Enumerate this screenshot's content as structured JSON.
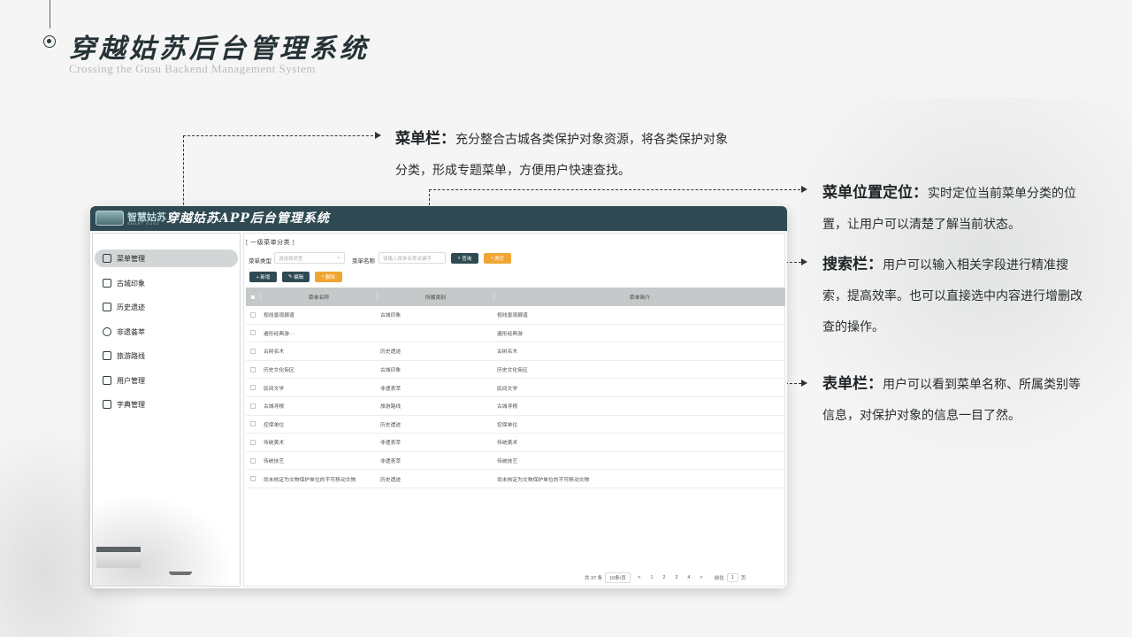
{
  "header": {
    "title": "穿越姑苏后台管理系统",
    "subtitle": "Crossing the Gusu Backend Management System"
  },
  "annotations": [
    {
      "heading": "菜单栏：",
      "text": "充分整合古城各类保护对象资源，将各类保护对象分类，形成专题菜单，方便用户快速查找。"
    },
    {
      "heading": "菜单位置定位：",
      "text": "实时定位当前菜单分类的位置，让用户可以清楚了解当前状态。"
    },
    {
      "heading": "搜索栏：",
      "text": "用户可以输入相关字段进行精准搜索，提高效率。也可以直接选中内容进行增删改查的操作。"
    },
    {
      "heading": "表单栏：",
      "text": "用户可以看到菜单名称、所属类别等信息，对保护对象的信息一目了然。"
    }
  ],
  "app": {
    "logo_text": "智慧姑苏",
    "logo_en": "SMART GUSU",
    "title": "穿越姑苏APP后台管理系统",
    "sidebar": [
      {
        "label": "菜单管理",
        "icon": "menu-icon",
        "active": true
      },
      {
        "label": "古城印象",
        "icon": "landscape-icon"
      },
      {
        "label": "历史遗迹",
        "icon": "building-icon"
      },
      {
        "label": "非遗荟萃",
        "icon": "gear-icon"
      },
      {
        "label": "旅游路线",
        "icon": "route-icon"
      },
      {
        "label": "用户管理",
        "icon": "user-icon"
      },
      {
        "label": "字典管理",
        "icon": "book-icon"
      }
    ],
    "breadcrumb": "[ 一级菜单分类 ]",
    "search": {
      "type_label": "菜单类型",
      "type_placeholder": "请选择类型",
      "name_label": "菜单名称",
      "name_placeholder": "请输入菜单名称关键字",
      "query_button": "查询",
      "clear_button": "清空"
    },
    "toolbar": {
      "add_button": "+ 新增",
      "edit_button": "编辑",
      "delete_button": "删除"
    },
    "table": {
      "columns": [
        "菜单名称",
        "所属类别",
        "菜单简介"
      ],
      "rows": [
        [
          "视线景观廊道",
          "古城印象",
          "视线景观廊道"
        ],
        [
          "遁形经典游···",
          "",
          "遁形经典游"
        ],
        [
          "古树名木",
          "历史遗迹",
          "古树名木"
        ],
        [
          "历史文化街区",
          "古城印象",
          "历史文化街区"
        ],
        [
          "民间文学",
          "非遗荟萃",
          "民间文学"
        ],
        [
          "古城寻根",
          "旅游路线",
          "古城寻根"
        ],
        [
          "控保单位",
          "历史遗迹",
          "控保单位"
        ],
        [
          "传统美术",
          "非遗荟萃",
          "传统美术"
        ],
        [
          "传统技艺",
          "非遗荟萃",
          "传统技艺"
        ],
        [
          "尚未核定为文物保护单位的不可移动文物",
          "历史遗迹",
          "尚未核定为文物保护单位的不可移动文物"
        ]
      ]
    },
    "pagination": {
      "total": "共 37 条",
      "page_size": "10条/页",
      "prev": "<",
      "pages": [
        "1",
        "2",
        "3",
        "4"
      ],
      "current": "1",
      "next": ">",
      "goto_label": "前往",
      "goto_value": "1",
      "goto_suffix": "页"
    }
  }
}
